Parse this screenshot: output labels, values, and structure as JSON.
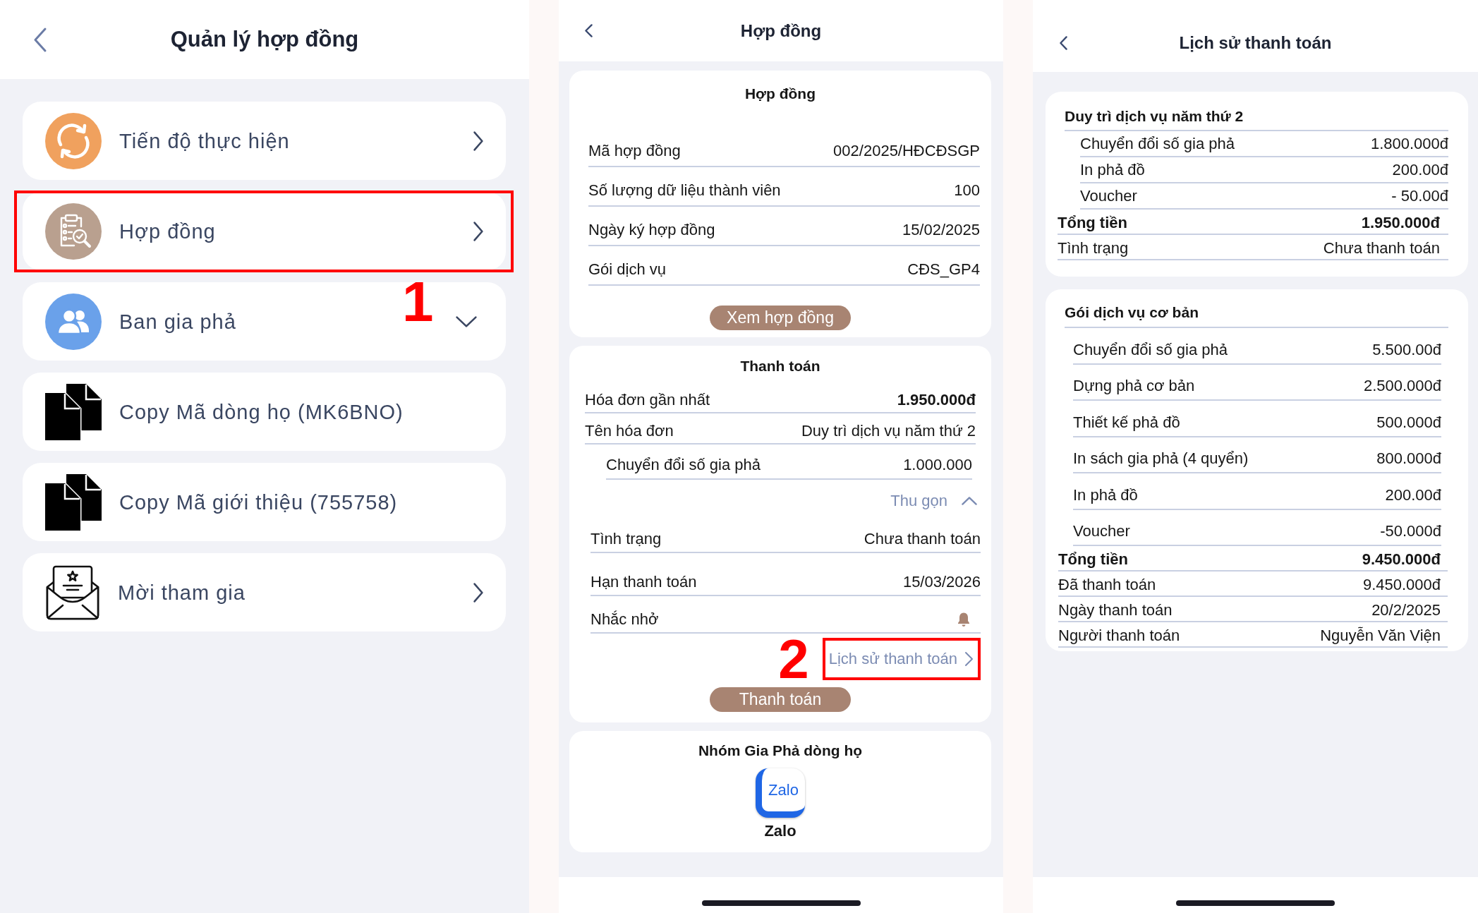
{
  "contract_management": {
    "title": "Quản lý hợp đồng",
    "items": [
      {
        "label": "Tiến độ thực hiện",
        "kind": "link",
        "highlighted": false
      },
      {
        "label": "Hợp đồng",
        "kind": "link",
        "highlighted": true,
        "step": "1"
      },
      {
        "label": "Ban gia phả",
        "kind": "expandable",
        "expanded": false,
        "highlighted": false
      },
      {
        "label": "Copy Mã dòng họ (MK6BNO)",
        "kind": "copy",
        "highlighted": false
      },
      {
        "label": "Copy Mã giới thiệu (755758)",
        "kind": "copy",
        "highlighted": false
      },
      {
        "label": "Mời tham gia",
        "kind": "link",
        "highlighted": false
      }
    ]
  },
  "contract": {
    "title": "Hợp đồng",
    "contract_card": {
      "heading": "Hợp đồng",
      "rows": [
        {
          "label": "Mã hợp đồng",
          "value": "002/2025/HĐCĐSGP"
        },
        {
          "label": "Số lượng dữ liệu thành viên",
          "value": "100"
        },
        {
          "label": "Ngày ký hợp đồng",
          "value": "15/02/2025"
        },
        {
          "label": "Gói dịch vụ",
          "value": "CĐS_GP4"
        }
      ],
      "button": "Xem hợp đồng"
    },
    "payment_card": {
      "heading": "Thanh toán",
      "invoice_rows": [
        {
          "kind": "emphasis",
          "label": "Hóa đơn gần nhất",
          "value": "1.950.000đ"
        },
        {
          "kind": "plain",
          "label": "Tên hóa đơn",
          "value": "Duy trì dịch vụ năm thứ 2"
        },
        {
          "kind": "sub",
          "label": "Chuyển đổi số gia phả",
          "value": "1.000.000"
        }
      ],
      "toggle": {
        "label": "Thu gọn",
        "expanded": true
      },
      "status_rows": [
        {
          "kind": "plain",
          "label": "Tình trạng",
          "value": "Chưa thanh toán"
        },
        {
          "kind": "plain",
          "label": "Hạn thanh toán",
          "value": "15/03/2026"
        },
        {
          "kind": "reminder",
          "label": "Nhắc nhở"
        }
      ],
      "history_link": {
        "label": "Lịch sử thanh toán",
        "highlighted": true,
        "step": "2"
      },
      "button": "Thanh toán"
    },
    "group_card": {
      "heading": "Nhóm Gia Phả dòng họ",
      "app_logo_text": "Zalo",
      "app_label": "Zalo"
    }
  },
  "payment_history": {
    "title": "Lịch sử thanh toán",
    "invoices": [
      {
        "title": "Duy trì dịch vụ năm thứ 2",
        "lines": [
          {
            "label": "Chuyển đổi số gia phả",
            "value": "1.800.000đ"
          },
          {
            "label": "In phả đồ",
            "value": "200.00đ"
          },
          {
            "label": "Voucher",
            "value": "- 50.00đ"
          }
        ],
        "summary": [
          {
            "kind": "total",
            "label": "Tổng tiền",
            "value": "1.950.000đ"
          },
          {
            "kind": "plain",
            "label": "Tình trạng",
            "value": "Chưa thanh toán"
          }
        ]
      },
      {
        "title": "Gói dịch vụ cơ bản",
        "lines": [
          {
            "label": "Chuyển đổi số gia phả",
            "value": "5.500.00đ"
          },
          {
            "label": "Dựng phả cơ bản",
            "value": "2.500.000đ"
          },
          {
            "label": "Thiết kế phả đồ",
            "value": "500.000đ"
          },
          {
            "label": "In sách gia phả (4 quyển)",
            "value": "800.000đ"
          },
          {
            "label": "In phả đồ",
            "value": "200.00đ"
          },
          {
            "label": "Voucher",
            "value": "-50.000đ"
          }
        ],
        "summary": [
          {
            "kind": "total",
            "label": "Tổng tiền",
            "value": "9.450.000đ"
          },
          {
            "kind": "plain",
            "label": "Đã thanh toán",
            "value": "9.450.000đ"
          },
          {
            "kind": "plain",
            "label": "Ngày thanh toán",
            "value": "20/2/2025"
          },
          {
            "kind": "plain",
            "label": "Người thanh toán",
            "value": "Nguyễn Văn Viện"
          }
        ]
      }
    ]
  }
}
